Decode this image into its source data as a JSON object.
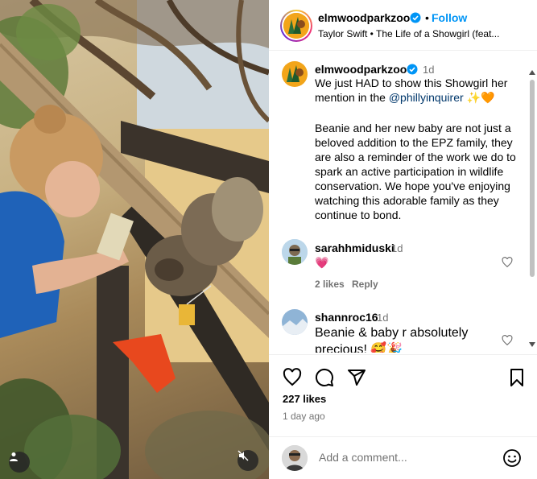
{
  "post": {
    "username": "elmwoodparkzoo",
    "follow_label": "Follow",
    "separator": "•",
    "audio_label": "Taylor Swift • The Life of a Showgirl (feat...",
    "more_label": "•••"
  },
  "caption": {
    "username": "elmwoodparkzoo",
    "time": "1d",
    "text_part1": "We just HAD to show this Showgirl her mention in the ",
    "mention": "@phillyinquirer",
    "text_part2": " ✨🧡",
    "paragraph2": "Beanie and her new baby are not just a beloved addition to the EPZ family, they are also a reminder of the work we do to spark an active participation in wildlife conservation. We hope you've enjoying watching this adorable family as they continue to bond."
  },
  "comments": [
    {
      "username": "sarahhmiduski",
      "time": "1d",
      "text": "💗",
      "likes": "2 likes",
      "reply_label": "Reply"
    },
    {
      "username": "shannroc16",
      "time": "1d",
      "text": "Beanie & baby r absolutely precious! 🥰🎉"
    }
  ],
  "engagement": {
    "likes": "227 likes",
    "date": "1 day ago"
  },
  "composer": {
    "placeholder": "Add a comment..."
  },
  "icons": {
    "like": "heart-icon",
    "comment": "comment-icon",
    "share": "share-icon",
    "save": "bookmark-icon",
    "emoji": "emoji-icon",
    "verified": "verified-badge-icon",
    "mute": "muted-speaker-icon",
    "tag": "user-tag-icon"
  },
  "colors": {
    "link": "#0095f6",
    "mention": "#00376b",
    "secondary_text": "#737373",
    "like_heart": "#ff3040"
  }
}
